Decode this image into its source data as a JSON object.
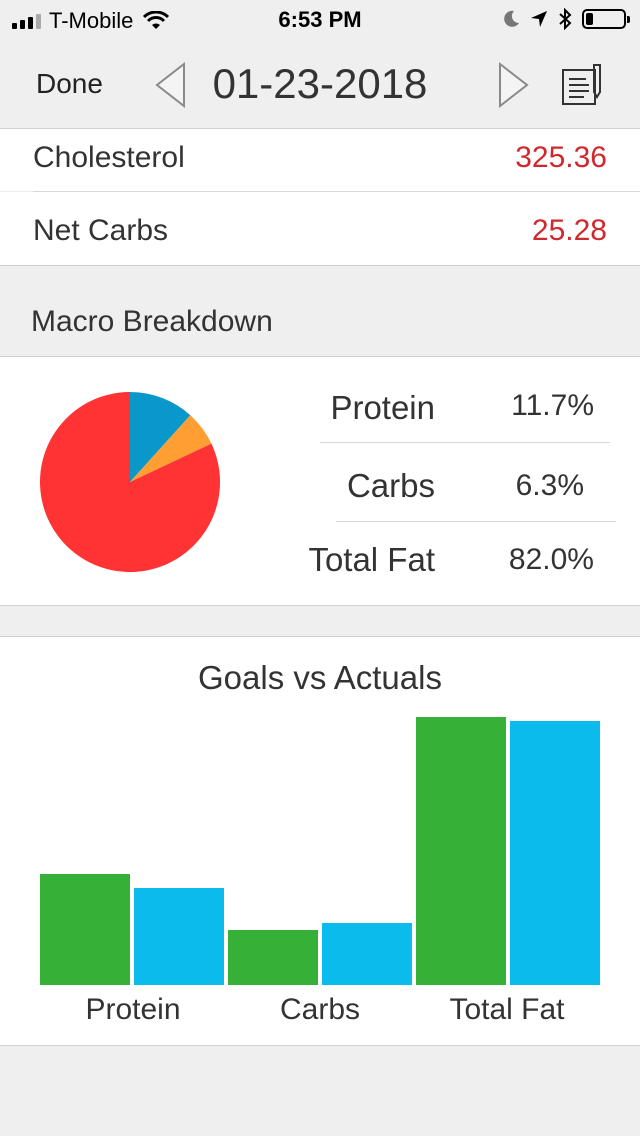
{
  "status_bar": {
    "carrier": "T-Mobile",
    "time": "6:53 PM",
    "icons": [
      "signal-icon",
      "wifi-icon",
      "moon-icon",
      "location-arrow-icon",
      "bluetooth-icon",
      "battery-icon"
    ],
    "battery_level": 0.2
  },
  "navbar": {
    "done_label": "Done",
    "date": "01-23-2018",
    "icons": [
      "chevron-left-icon",
      "chevron-right-icon",
      "document-edit-icon"
    ]
  },
  "nutrients": [
    {
      "label": "Cholesterol",
      "value": "325.36"
    },
    {
      "label": "Net Carbs",
      "value": "25.28"
    }
  ],
  "macro_breakdown": {
    "header": "Macro Breakdown",
    "items": [
      {
        "name": "Protein",
        "pct": "11.7%",
        "color": "#0a98cb"
      },
      {
        "name": "Carbs",
        "pct": "6.3%",
        "color": "#ff9f33"
      },
      {
        "name": "Total Fat",
        "pct": "82.0%",
        "color": "#ff3333"
      }
    ]
  },
  "chart_data": [
    {
      "type": "pie",
      "categories": [
        "Protein",
        "Carbs",
        "Total Fat"
      ],
      "values": [
        11.7,
        6.3,
        82.0
      ],
      "colors": [
        "#0a98cb",
        "#ff9f33",
        "#ff3333"
      ]
    },
    {
      "type": "bar",
      "title": "Goals vs Actuals",
      "categories": [
        "Protein",
        "Carbs",
        "Total Fat"
      ],
      "series": [
        {
          "values": [
            41.5,
            20.5,
            100
          ],
          "color": "#37b037"
        },
        {
          "values": [
            36.3,
            23.0,
            98.5
          ],
          "color": "#0abbec"
        }
      ],
      "ylim": [
        0,
        100
      ],
      "grid": false,
      "legend": "none"
    }
  ]
}
